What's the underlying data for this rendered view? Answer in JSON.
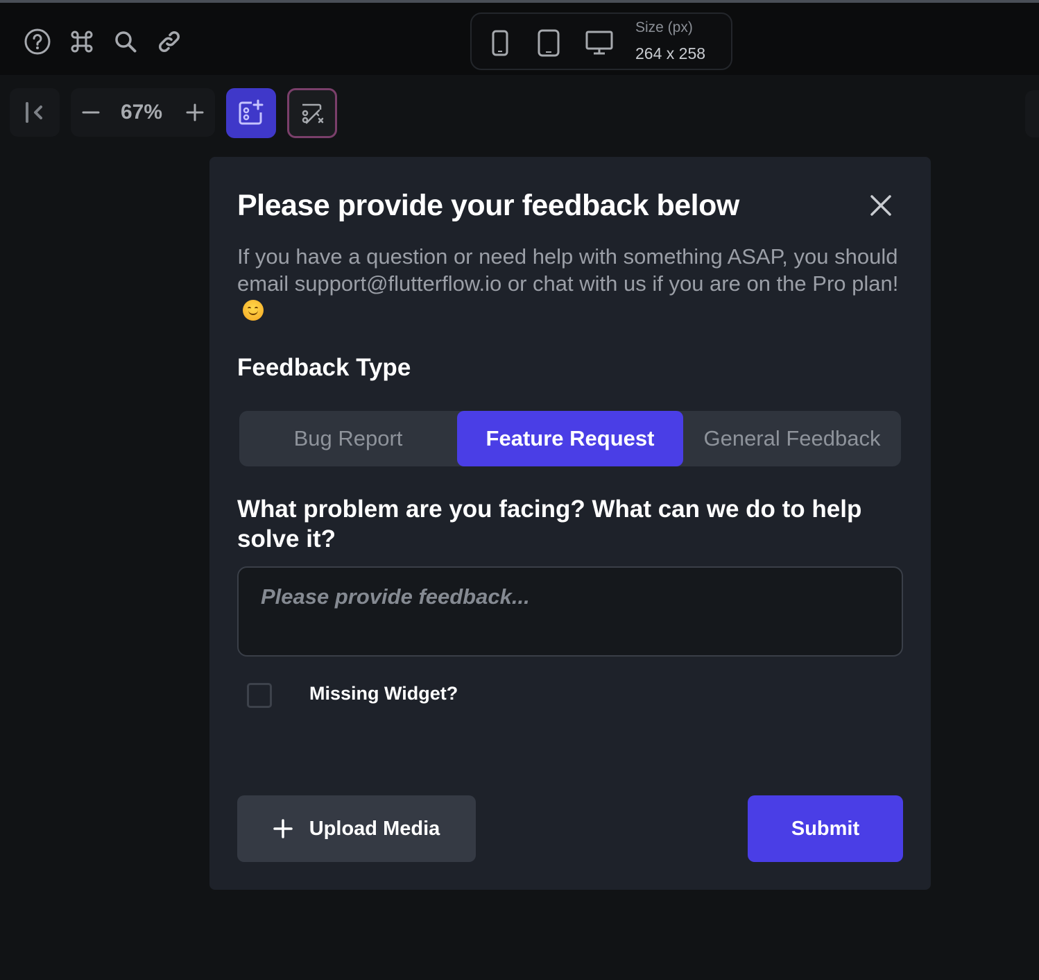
{
  "toolbar": {
    "icons": [
      "help-icon",
      "command-icon",
      "search-icon",
      "link-icon"
    ],
    "devices": [
      "phone-icon",
      "tablet-icon",
      "desktop-icon"
    ],
    "size_label": "Size (px)",
    "size_value": "264 x 258"
  },
  "canvas_controls": {
    "zoom_value": "67%"
  },
  "dialog": {
    "title": "Please provide your feedback below",
    "subtitle": "If you have a question or need help with something ASAP, you should email support@flutterflow.io or chat with us if you are on the Pro plan!",
    "feedback_type_label": "Feedback Type",
    "tabs": [
      {
        "label": "Bug Report",
        "active": false
      },
      {
        "label": "Feature Request",
        "active": true
      },
      {
        "label": "General Feedback",
        "active": false
      }
    ],
    "question": "What problem are you facing? What can we do to help solve it?",
    "feedback_placeholder": "Please provide feedback...",
    "checkbox_label": "Missing Widget?",
    "upload_label": "Upload Media",
    "submit_label": "Submit"
  },
  "colors": {
    "accent": "#4a3ee6",
    "dialog_bg": "#1e222a",
    "page_bg": "#111315"
  }
}
